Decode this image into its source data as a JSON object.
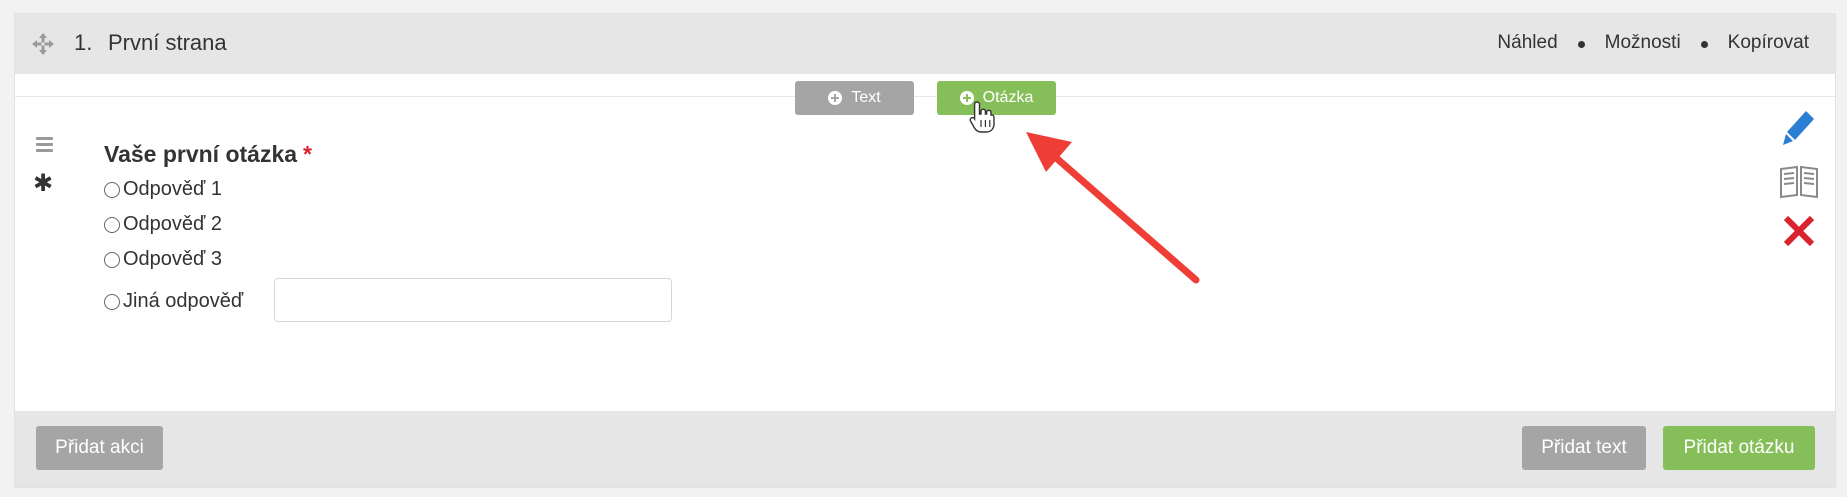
{
  "page": {
    "number": "1.",
    "title": "První strana",
    "links": [
      "Náhled",
      "Možnosti",
      "Kopírovat"
    ]
  },
  "insert": {
    "text_label": "Text",
    "question_label": "Otázka"
  },
  "question": {
    "title": "Vaše první otázka",
    "required_mark": "*",
    "options": [
      "Odpověď 1",
      "Odpověď 2",
      "Odpověď 3"
    ],
    "other_label": "Jiná odpověď",
    "other_value": ""
  },
  "footer": {
    "add_action": "Přidat akci",
    "add_text": "Přidat text",
    "add_question": "Přidat otázku"
  },
  "icons": {
    "move": "move-icon",
    "hamburger": "hamburger-icon",
    "asterisk": "asterisk-icon",
    "edit": "pencil-icon",
    "preview": "book-icon",
    "delete": "close-icon",
    "cursor": "hand-cursor-icon"
  },
  "colors": {
    "accent_green": "#86bf5a",
    "neutral_gray": "#a5a5a5",
    "required_red": "#d9232d",
    "edit_blue": "#2a7fd4",
    "delete_red": "#d9232d",
    "annotation_red": "#ef3e36"
  }
}
